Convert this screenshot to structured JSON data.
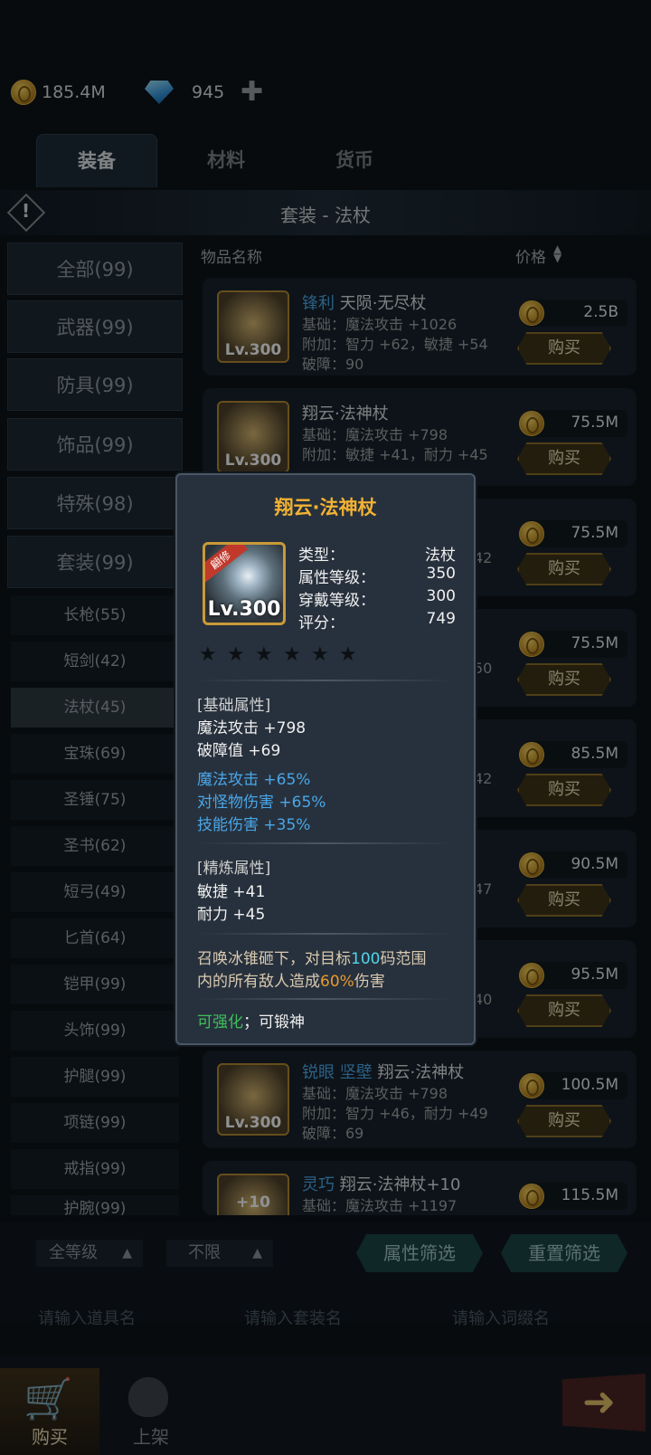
{
  "currency": {
    "gold": "185.4M",
    "diamond": "945"
  },
  "tabs": [
    {
      "label": "装备"
    },
    {
      "label": "材料"
    },
    {
      "label": "货币"
    }
  ],
  "section_title": "套装 - 法杖",
  "list_header": {
    "name": "物品名称",
    "price": "价格"
  },
  "categories": [
    {
      "label": "全部(99)"
    },
    {
      "label": "武器(99)"
    },
    {
      "label": "防具(99)"
    },
    {
      "label": "饰品(99)"
    },
    {
      "label": "特殊(98)"
    },
    {
      "label": "套装(99)"
    }
  ],
  "subcategories": [
    {
      "label": "长枪(55)"
    },
    {
      "label": "短剑(42)"
    },
    {
      "label": "法杖(45)"
    },
    {
      "label": "宝珠(69)"
    },
    {
      "label": "圣锤(75)"
    },
    {
      "label": "圣书(62)"
    },
    {
      "label": "短弓(49)"
    },
    {
      "label": "匕首(64)"
    },
    {
      "label": "铠甲(99)"
    },
    {
      "label": "头饰(99)"
    },
    {
      "label": "护腿(99)"
    },
    {
      "label": "项链(99)"
    },
    {
      "label": "戒指(99)"
    },
    {
      "label": "护腕(99)"
    }
  ],
  "items": [
    {
      "prefix": "锋利",
      "name": "天陨·无尽杖",
      "base": "基础：魔法攻击 +1026",
      "extra": "附加：智力 +62，敏捷 +54",
      "break": "破障：90",
      "level": "Lv.300",
      "price": "2.5B",
      "buy": "购买"
    },
    {
      "prefix": "",
      "name": "翔云·法神杖",
      "base": "基础：魔法攻击 +798",
      "extra": "附加：敏捷 +41，耐力 +45",
      "break": "破障：69",
      "level": "Lv.300",
      "price": "75.5M",
      "buy": "购买"
    },
    {
      "price": "75.5M",
      "buy": "购买",
      "tail": "42"
    },
    {
      "price": "75.5M",
      "buy": "购买",
      "tail": "50"
    },
    {
      "price": "85.5M",
      "buy": "购买",
      "tail": "42"
    },
    {
      "price": "90.5M",
      "buy": "购买",
      "tail": "47"
    },
    {
      "price": "95.5M",
      "buy": "购买",
      "tail": "40"
    },
    {
      "prefix": "锐眼 坚壁",
      "name": "翔云·法神杖",
      "base": "基础：魔法攻击 +798",
      "extra": "附加：智力 +46，耐力 +49",
      "break": "破障：69",
      "level": "Lv.300",
      "price": "100.5M",
      "buy": "购买"
    },
    {
      "prefix": "灵巧",
      "name": "翔云·法神杖+10",
      "base": "基础：魔法攻击 +1197",
      "level": "+10",
      "price": "115.5M"
    }
  ],
  "popup": {
    "title": "翔云·法神杖",
    "badge": "翩修",
    "level": "Lv.300",
    "stats": [
      {
        "k": "类型：",
        "v": "法杖"
      },
      {
        "k": "属性等级：",
        "v": "350"
      },
      {
        "k": "穿戴等级：",
        "v": "300"
      },
      {
        "k": "评分：",
        "v": "749"
      }
    ],
    "base_header": "[基础属性]",
    "base": [
      "魔法攻击 +798",
      "破障值 +69"
    ],
    "bonus": [
      "魔法攻击 +65%",
      "对怪物伤害 +65%",
      "技能伤害 +35%"
    ],
    "refine_header": "[精炼属性]",
    "refine": [
      "敏捷 +41",
      "耐力 +45"
    ],
    "skill": {
      "a": "召唤冰锥砸下，对目标",
      "n1": "100",
      "b": "码范围",
      "c": "内的所有敌人造成",
      "n2": "60%",
      "d": "伤害"
    },
    "footer": {
      "enh": "可强化",
      "sep": "；",
      "forge": "可锻神"
    }
  },
  "filters": {
    "level": "全等级",
    "limit": "不限",
    "attr": "属性筛选",
    "reset": "重置筛选"
  },
  "inputs": {
    "item": "请输入道具名",
    "set": "请输入套装名",
    "affix": "请输入词缀名"
  },
  "bottom_nav": [
    {
      "label": "购买"
    },
    {
      "label": "上架"
    }
  ],
  "colors": {
    "gold": "#f2b233",
    "accent_blue": "#4aa6e8",
    "green": "#3fbf5a",
    "cyan": "#4fd6e8",
    "orange": "#e89a2e"
  }
}
